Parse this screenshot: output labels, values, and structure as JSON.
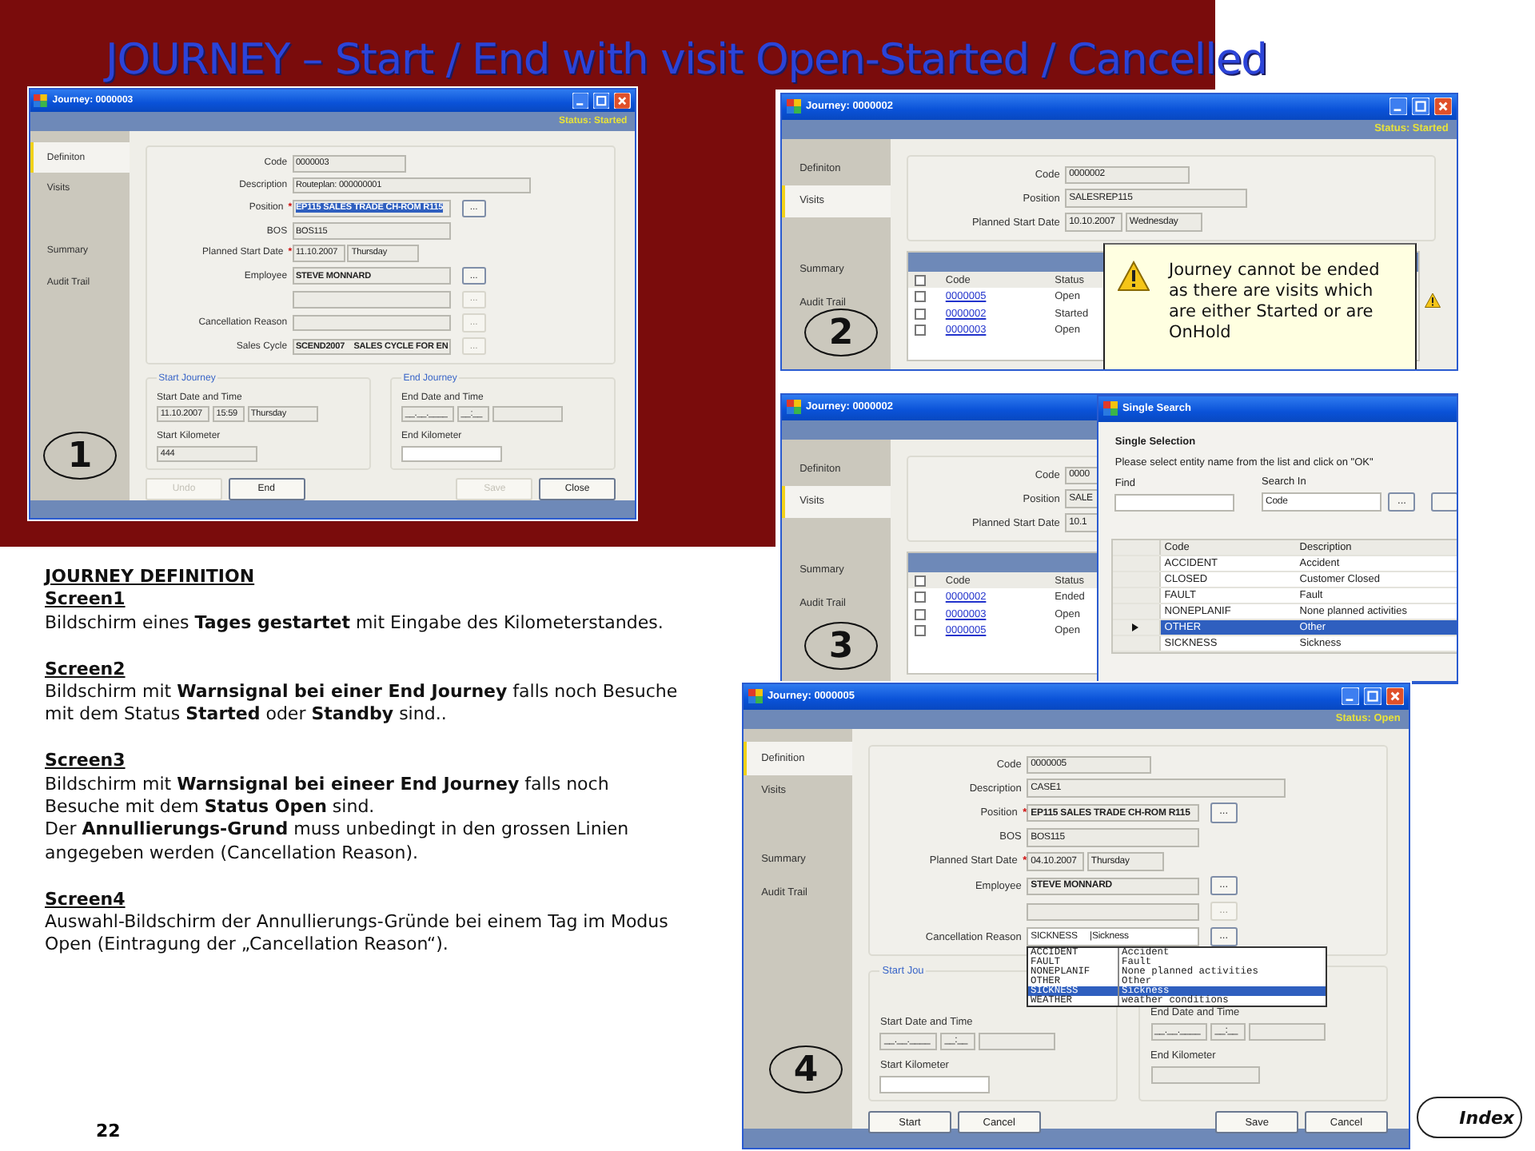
{
  "slide": {
    "title": "JOURNEY – Start / End with visit Open-Started / Cancelled",
    "page_number": "22",
    "index_button": "Index"
  },
  "screens": [
    {
      "number": "1",
      "title": "Journey: 0000003",
      "status": "Status: Started",
      "nav": [
        {
          "label": "Definiton",
          "selected": true
        },
        {
          "label": "Visits",
          "selected": false
        },
        {
          "label": "Summary",
          "selected": false
        },
        {
          "label": "Audit Trail",
          "selected": false
        }
      ],
      "form": [
        {
          "label": "Code",
          "fields": [
            {
              "kind": "short",
              "value": "0000003",
              "editable": false
            }
          ]
        },
        {
          "label": "Description",
          "fields": [
            {
              "kind": "wide",
              "value": "Routeplan: 000000001",
              "editable": false
            }
          ]
        },
        {
          "label": "Position",
          "required": "*",
          "fields": [
            {
              "kind": "medium",
              "value": "EP115 SALES TRADE CH-ROM R115",
              "bold": true,
              "selected": true,
              "editable": false
            }
          ],
          "button": {
            "label": "...",
            "disabled": false
          }
        },
        {
          "label": "BOS",
          "fields": [
            {
              "kind": "medium",
              "value": "BOS115",
              "editable": false
            }
          ]
        },
        {
          "label": "Planned Start Date",
          "required": "*",
          "fields": [
            {
              "kind": "date",
              "value": "11.10.2007",
              "editable": false
            },
            {
              "kind": "day",
              "value": "Thursday",
              "editable": false
            }
          ]
        },
        {
          "label": "Employee",
          "fields": [
            {
              "kind": "medium",
              "value": "STEVE MONNARD",
              "bold": true,
              "editable": false
            }
          ],
          "button": {
            "label": "...",
            "disabled": false
          }
        },
        {
          "fields": [
            {
              "kind": "medium",
              "editable": false
            }
          ],
          "button": {
            "label": "...",
            "disabled": true
          }
        },
        {
          "label": "Cancellation Reason",
          "fields": [
            {
              "kind": "medium",
              "editable": false
            }
          ],
          "button": {
            "label": "...",
            "disabled": true
          }
        },
        {
          "label": "Sales Cycle",
          "fields": [
            {
              "kind": "medium",
              "value": "SCEND2007    SALES CYCLE FOR EN",
              "bold": true,
              "editable": false
            }
          ],
          "button": {
            "label": "...",
            "disabled": true
          }
        }
      ],
      "groups": [
        {
          "title": "Start Journey",
          "items": [
            {
              "label": "Start Date and Time",
              "fields": [
                {
                  "kind": "date",
                  "value": "11.10.2007",
                  "editable": false
                },
                {
                  "kind": "time",
                  "value": "15:59",
                  "editable": false
                },
                {
                  "kind": "day",
                  "value": "Thursday",
                  "editable": false
                }
              ]
            },
            {
              "label": "Start Kilometer",
              "fields": [
                {
                  "kind": "km",
                  "value": "444",
                  "editable": false
                }
              ]
            }
          ]
        },
        {
          "title": "End Journey",
          "items": [
            {
              "label": "End Date and Time",
              "fields": [
                {
                  "kind": "date",
                  "value": "__.__.____",
                  "editable": false
                },
                {
                  "kind": "time",
                  "value": "__:__",
                  "editable": false
                },
                {
                  "kind": "day",
                  "editable": false
                }
              ]
            },
            {
              "label": "End Kilometer",
              "fields": [
                {
                  "kind": "km",
                  "editable": true
                }
              ]
            }
          ]
        }
      ],
      "buttons_left": [
        {
          "label": "Undo",
          "disabled": true
        },
        {
          "label": "End",
          "disabled": false
        }
      ],
      "buttons_right": [
        {
          "label": "Save",
          "disabled": true
        },
        {
          "label": "Close",
          "disabled": false
        }
      ]
    },
    {
      "number": "2",
      "title": "Journey: 0000002",
      "status": "Status: Started",
      "nav": [
        {
          "label": "Definiton",
          "selected": false
        },
        {
          "label": "Visits",
          "selected": true
        },
        {
          "label": "Summary",
          "selected": false
        },
        {
          "label": "Audit Trail",
          "selected": false
        }
      ],
      "form": [
        {
          "label": "Code",
          "fields": [
            {
              "kind": "short",
              "value": "0000002",
              "editable": false
            }
          ]
        },
        {
          "label": "Position",
          "fields": [
            {
              "kind": "long",
              "value": "SALESREP115",
              "editable": false
            }
          ]
        },
        {
          "label": "Planned Start Date",
          "fields": [
            {
              "kind": "date",
              "value": "10.10.2007",
              "editable": false
            },
            {
              "kind": "day",
              "value": "Wednesday",
              "editable": false
            }
          ]
        }
      ],
      "visits": {
        "header_checked": false,
        "columns": [
          "Code",
          "Status"
        ],
        "rows": [
          {
            "checked": false,
            "code": "0000005",
            "status": "Open"
          },
          {
            "checked": false,
            "code": "0000002",
            "status": "Started"
          },
          {
            "checked": false,
            "code": "0000003",
            "status": "Open"
          }
        ]
      },
      "warning": {
        "text": "Journey cannot be ended as there are visits which are either Started or are OnHold"
      }
    },
    {
      "number": "3",
      "title": "Journey: 0000002",
      "nav": [
        {
          "label": "Definiton",
          "selected": false
        },
        {
          "label": "Visits",
          "selected": true
        },
        {
          "label": "Summary",
          "selected": false
        },
        {
          "label": "Audit Trail",
          "selected": false
        }
      ],
      "form": [
        {
          "label": "Code",
          "fields": [
            {
              "kind": "short",
              "value": "0000",
              "editable": false
            }
          ]
        },
        {
          "label": "Position",
          "fields": [
            {
              "kind": "long",
              "value": "SALE",
              "editable": false
            }
          ]
        },
        {
          "label": "Planned Start Date",
          "fields": [
            {
              "kind": "date",
              "value": "10.1",
              "editable": false
            }
          ]
        }
      ],
      "visits": {
        "header_checked": false,
        "columns": [
          "Code",
          "Status"
        ],
        "rows": [
          {
            "checked": false,
            "code": "0000002",
            "status": "Ended"
          },
          {
            "checked": false,
            "code": "0000003",
            "status": "Open"
          },
          {
            "checked": false,
            "code": "0000005",
            "status": "Open"
          }
        ]
      },
      "dialog": {
        "title": "Single Search",
        "heading": "Single Selection",
        "instruction": "Please select entity name from the list  and click on \"OK\"",
        "find_label": "Find",
        "search_in_label": "Search In",
        "search_in_value": "Code",
        "button": "...",
        "columns": [
          "Code",
          "Description"
        ],
        "rows": [
          {
            "code": "ACCIDENT",
            "description": "Accident",
            "selected": false
          },
          {
            "code": "CLOSED",
            "description": "Customer Closed",
            "selected": false
          },
          {
            "code": "FAULT",
            "description": "Fault",
            "selected": false
          },
          {
            "code": "NONEPLANIF",
            "description": "None planned activities",
            "selected": false
          },
          {
            "code": "OTHER",
            "description": "Other",
            "selected": true
          },
          {
            "code": "SICKNESS",
            "description": "Sickness",
            "selected": false
          }
        ]
      }
    },
    {
      "number": "4",
      "title": "Journey: 0000005",
      "status": "Status: Open",
      "nav": [
        {
          "label": "Definition",
          "selected": true
        },
        {
          "label": "Visits",
          "selected": false
        },
        {
          "label": "Summary",
          "selected": false
        },
        {
          "label": "Audit Trail",
          "selected": false
        }
      ],
      "form": [
        {
          "label": "Code",
          "fields": [
            {
              "kind": "short",
              "value": "0000005",
              "editable": false
            }
          ]
        },
        {
          "label": "Description",
          "fields": [
            {
              "kind": "wide",
              "value": "CASE1",
              "editable": false
            }
          ]
        },
        {
          "label": "Position",
          "required": "*",
          "fields": [
            {
              "kind": "medium",
              "value": "EP115 SALES TRADE CH-ROM R115",
              "bold": true,
              "editable": false
            }
          ],
          "button": {
            "label": "...",
            "disabled": false
          }
        },
        {
          "label": "BOS",
          "fields": [
            {
              "kind": "medium",
              "value": "BOS115",
              "editable": false
            }
          ]
        },
        {
          "label": "Planned Start Date",
          "required": "*",
          "fields": [
            {
              "kind": "date",
              "value": "04.10.2007",
              "editable": false
            },
            {
              "kind": "day",
              "value": "Thursday",
              "editable": false
            }
          ]
        },
        {
          "label": "Employee",
          "fields": [
            {
              "kind": "medium",
              "value": "STEVE MONNARD",
              "bold": true,
              "editable": false
            }
          ],
          "button": {
            "label": "...",
            "disabled": false
          }
        },
        {
          "fields": [
            {
              "kind": "medium",
              "editable": false
            }
          ],
          "button": {
            "label": "...",
            "disabled": true
          }
        },
        {
          "label": "Cancellation Reason",
          "fields": [
            {
              "kind": "medium",
              "value": "SICKNESS     |Sickness",
              "editable": true
            }
          ],
          "button": {
            "label": "...",
            "disabled": false
          },
          "dropdown": [
            {
              "code": "ACCIDENT",
              "description": "Accident",
              "selected": false
            },
            {
              "code": "FAULT",
              "description": "Fault",
              "selected": false
            },
            {
              "code": "NONEPLANIF",
              "description": "None planned activities",
              "selected": false
            },
            {
              "code": "OTHER",
              "description": "Other",
              "selected": false
            },
            {
              "code": "SICKNESS",
              "description": "Sickness",
              "selected": true
            },
            {
              "code": "WEATHER",
              "description": "weather conditions",
              "selected": false
            }
          ]
        }
      ],
      "groups": [
        {
          "title": "Start Jou",
          "items": [
            {
              "label": "Start Date and Time",
              "fields": [
                {
                  "kind": "date",
                  "value": "__.__.____",
                  "editable": false
                },
                {
                  "kind": "time",
                  "value": "__:__",
                  "editable": false
                },
                {
                  "kind": "day",
                  "editable": false
                }
              ]
            },
            {
              "label": "Start Kilometer",
              "fields": [
                {
                  "kind": "km",
                  "editable": true
                }
              ]
            }
          ]
        },
        {
          "items": [
            {
              "label": "End Date and Time",
              "fields": [
                {
                  "kind": "date",
                  "value": "__.__.____",
                  "editable": false
                },
                {
                  "kind": "time",
                  "value": "__:__",
                  "editable": false
                },
                {
                  "kind": "day",
                  "editable": false
                }
              ]
            },
            {
              "label": "End Kilometer",
              "fields": [
                {
                  "kind": "km",
                  "editable": false
                }
              ]
            }
          ]
        }
      ],
      "buttons_left": [
        {
          "label": "Start",
          "disabled": false
        },
        {
          "label": "Cancel",
          "disabled": false
        }
      ],
      "buttons_right": [
        {
          "label": "Save",
          "disabled": false
        },
        {
          "label": "Cancel",
          "disabled": false
        }
      ]
    }
  ],
  "notes": {
    "heading": "JOURNEY DEFINITION",
    "sections": [
      {
        "heading": "Screen1",
        "paragraphs": [
          "Bildschirm eines **Tages gestartet** mit Eingabe des Kilometerstandes."
        ]
      },
      {
        "heading": "Screen2",
        "paragraphs": [
          "Bildschirm mit **Warnsignal bei einer End Journey** falls noch Besuche mit dem Status **Started** oder **Standby** sind.."
        ]
      },
      {
        "heading": "Screen3",
        "paragraphs": [
          "Bildschirm mit **Warnsignal bei eineer End Journey** falls noch Besuche mit dem **Status Open** sind.",
          "Der **Annullierungs-Grund** muss unbedingt in den grossen Linien angegeben werden (Cancellation Reason)."
        ]
      },
      {
        "heading": "Screen4",
        "paragraphs": [
          "Auswahl-Bildschirm der Annullierungs-Gründe bei einem Tag im Modus Open (Eintragung der „Cancellation Reason“)."
        ]
      }
    ]
  }
}
